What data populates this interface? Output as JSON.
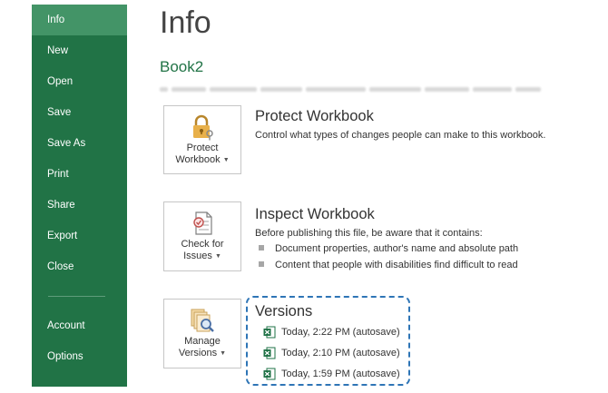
{
  "sidebar": {
    "items": [
      {
        "label": "Info"
      },
      {
        "label": "New"
      },
      {
        "label": "Open"
      },
      {
        "label": "Save"
      },
      {
        "label": "Save As"
      },
      {
        "label": "Print"
      },
      {
        "label": "Share"
      },
      {
        "label": "Export"
      },
      {
        "label": "Close"
      }
    ],
    "bottom_items": [
      {
        "label": "Account"
      },
      {
        "label": "Options"
      }
    ]
  },
  "header": {
    "title": "Info",
    "doc_name": "Book2"
  },
  "protect": {
    "button_line1": "Protect",
    "button_line2": "Workbook",
    "title": "Protect Workbook",
    "description": "Control what types of changes people can make to this workbook."
  },
  "inspect": {
    "button_line1": "Check for",
    "button_line2": "Issues",
    "title": "Inspect Workbook",
    "description": "Before publishing this file, be aware that it contains:",
    "bullets": [
      "Document properties, author's name and absolute path",
      "Content that people with disabilities find difficult to read"
    ]
  },
  "versions": {
    "button_line1": "Manage",
    "button_line2": "Versions",
    "title": "Versions",
    "items": [
      "Today, 2:22 PM (autosave)",
      "Today, 2:10 PM (autosave)",
      "Today, 1:59 PM (autosave)"
    ]
  },
  "colors": {
    "sidebar": "#217346",
    "sidebar_active": "#439467",
    "accent_green": "#217346",
    "highlight_dash": "#2e75b6"
  },
  "icons": [
    "lock-key-icon",
    "inspect-document-icon",
    "manage-versions-icon",
    "excel-file-icon",
    "caret-down-icon"
  ]
}
